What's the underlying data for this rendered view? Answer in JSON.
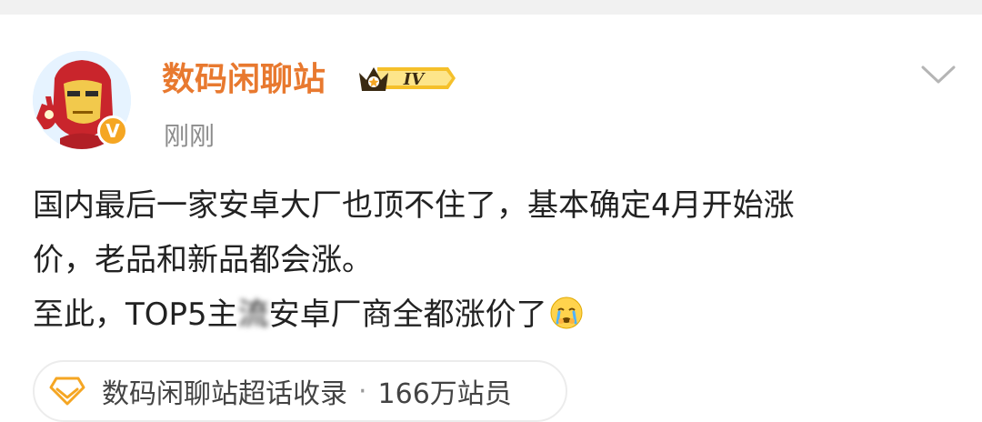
{
  "post": {
    "username": "数码闲聊站",
    "level_text": "IV",
    "timestamp": "刚刚",
    "lines": {
      "line1": "国内最后一家安卓大厂也顶不住了，基本确定4月开始涨",
      "line2": "价，老品和新品都会涨。",
      "line3_a": "至此，TOP5主",
      "line3_blur": "流",
      "line3_b": "安卓厂商全都涨价了"
    },
    "emoji": "crying-face-emoji"
  },
  "topic": {
    "name": "数码闲聊站超话收录",
    "separator": "·",
    "members": "166万站员"
  },
  "colors": {
    "username": "#e8792f",
    "verified": "#f5a623",
    "text": "#222222",
    "muted": "#8c8c8c",
    "topic_icon": "#f5a623"
  }
}
